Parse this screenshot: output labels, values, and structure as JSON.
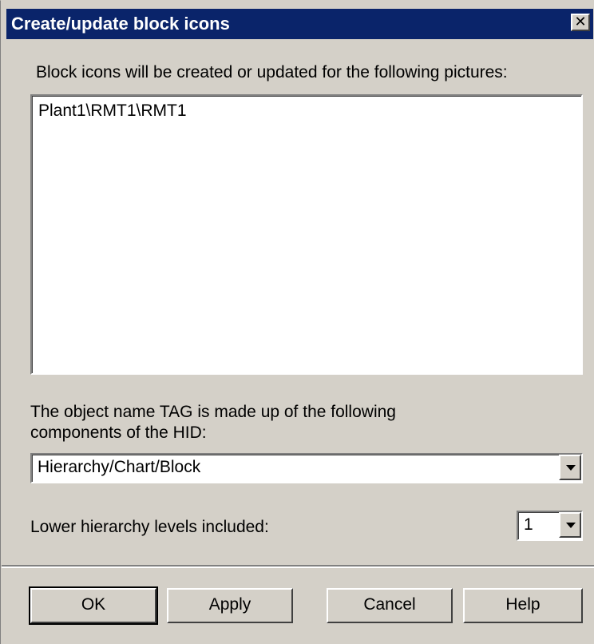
{
  "window": {
    "title": "Create/update block icons",
    "close_glyph": "✕"
  },
  "intro_label": "Block icons will be created or updated for the following pictures:",
  "pictures_list": [
    "Plant1\\RMT1\\RMT1"
  ],
  "tag_label_line1": "The object name TAG is made up of the following",
  "tag_label_line2": "components of the HID:",
  "tag_combo": {
    "selected": "Hierarchy/Chart/Block"
  },
  "levels_label": "Lower hierarchy levels included:",
  "levels_combo": {
    "selected": "1"
  },
  "buttons": {
    "ok": "OK",
    "apply": "Apply",
    "cancel": "Cancel",
    "help": "Help"
  },
  "icons": [
    "close-icon",
    "chevron-down-icon"
  ],
  "colors": {
    "titlebar": "#0a246a",
    "face": "#d4d0c8"
  }
}
